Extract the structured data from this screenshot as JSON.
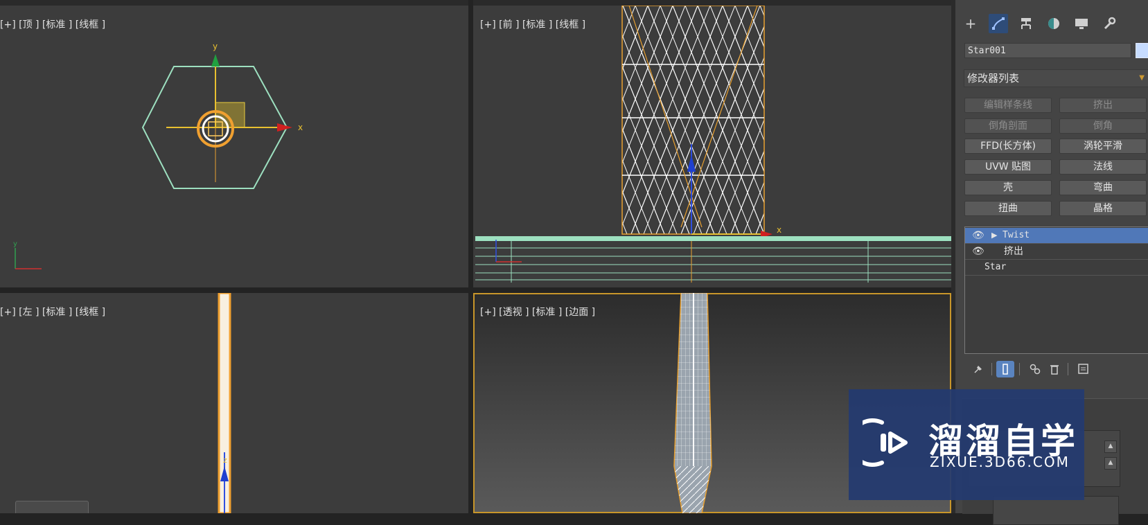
{
  "viewports": {
    "top": {
      "label": "[+] [顶 ] [标准 ] [线框 ]"
    },
    "front": {
      "label": "[+] [前 ] [标准 ] [线框 ]"
    },
    "left": {
      "label": "[+] [左 ] [标准 ] [线框 ]"
    },
    "perspective": {
      "label": "[+] [透视 ] [标准 ] [边面 ]"
    }
  },
  "axes": {
    "x": "x",
    "y": "y",
    "z": "z"
  },
  "command_panel": {
    "tabs": [
      "create-icon",
      "modify-icon",
      "hierarchy-icon",
      "motion-icon",
      "display-icon",
      "utilities-icon"
    ],
    "active_tab": "modify-icon",
    "object_name": "Star001",
    "object_color": "#c7dcff",
    "modifier_list_label": "修改器列表",
    "modifier_buttons": [
      {
        "label": "编辑样条线",
        "enabled": false
      },
      {
        "label": "挤出",
        "enabled": false
      },
      {
        "label": "倒角剖面",
        "enabled": false
      },
      {
        "label": "倒角",
        "enabled": false
      },
      {
        "label": "FFD(长方体)",
        "enabled": true
      },
      {
        "label": "涡轮平滑",
        "enabled": true
      },
      {
        "label": "UVW 贴图",
        "enabled": true
      },
      {
        "label": "法线",
        "enabled": true
      },
      {
        "label": "壳",
        "enabled": true
      },
      {
        "label": "弯曲",
        "enabled": true
      },
      {
        "label": "扭曲",
        "enabled": true
      },
      {
        "label": "晶格",
        "enabled": true
      }
    ],
    "stack": [
      {
        "label": "Twist",
        "selected": true,
        "eye": true,
        "expand": true
      },
      {
        "label": "挤出",
        "selected": false,
        "eye": true,
        "expand": false
      },
      {
        "label": "Star",
        "selected": false,
        "eye": false,
        "expand": false
      }
    ],
    "stack_tools": [
      "pin-icon",
      "show-end-result-icon",
      "make-unique-icon",
      "remove-modifier-icon",
      "configure-sets-icon"
    ]
  },
  "watermark": {
    "title": "溜溜自学",
    "subtitle": "ZIXUE.3D66.COM"
  },
  "colors": {
    "accent": "#5078b8",
    "selection_orange": "#f0a030",
    "viewport_border": "#c8962a",
    "grid_green": "#9de0c0"
  }
}
